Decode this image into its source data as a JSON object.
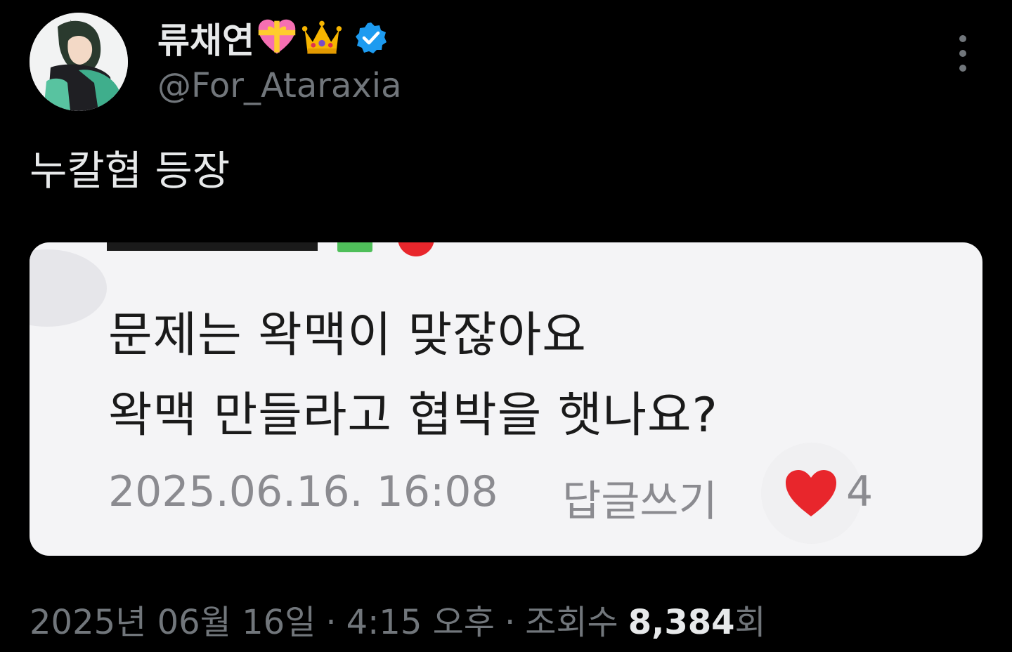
{
  "author": {
    "display_name": "류채연",
    "emojis": [
      "gift-heart-emoji",
      "crown-emoji"
    ],
    "verified": true,
    "handle": "@For_Ataraxia",
    "avatar": "anime-character-avatar"
  },
  "tweet": {
    "text": "누칼협 등장"
  },
  "media": {
    "comment_line_1": "문제는 왁맥이 맞잖아요",
    "comment_line_2": "왁맥 만들라고 협박을 햇나요?",
    "comment_date": "2025.06.16. 16:08",
    "reply_label": "답글쓰기",
    "like_count": "4"
  },
  "meta": {
    "date": "2025년 06월 16일",
    "separator": "·",
    "time": "4:15 오후",
    "views_label": "조회수",
    "views_count": "8,384",
    "views_suffix": "회"
  },
  "colors": {
    "background": "#000000",
    "primary_text": "#e7e9ea",
    "secondary_text": "#71767b",
    "verified_blue": "#1d9bf0",
    "card_background": "#f4f4f6",
    "heart_red": "#e8262c"
  }
}
